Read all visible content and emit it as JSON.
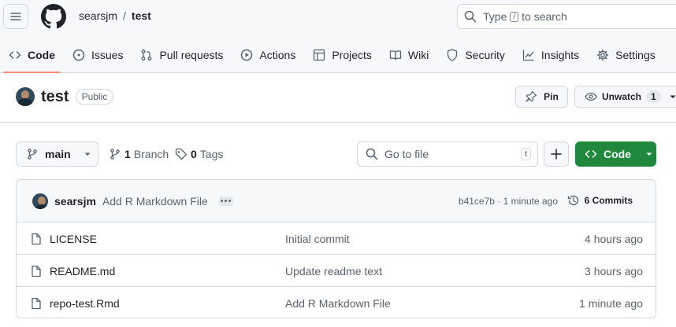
{
  "header": {
    "owner": "searsjm",
    "separator": "/",
    "repo": "test",
    "search_prefix": "Type",
    "search_key": "/",
    "search_suffix": "to search"
  },
  "tabs": [
    {
      "label": "Code",
      "icon": "code-icon",
      "active": true
    },
    {
      "label": "Issues",
      "icon": "issue-icon"
    },
    {
      "label": "Pull requests",
      "icon": "pull-request-icon"
    },
    {
      "label": "Actions",
      "icon": "play-icon"
    },
    {
      "label": "Projects",
      "icon": "table-icon"
    },
    {
      "label": "Wiki",
      "icon": "book-icon"
    },
    {
      "label": "Security",
      "icon": "shield-icon"
    },
    {
      "label": "Insights",
      "icon": "graph-icon"
    },
    {
      "label": "Settings",
      "icon": "gear-icon"
    }
  ],
  "repo_header": {
    "name": "test",
    "visibility": "Public",
    "pin_label": "Pin",
    "watch_label": "Unwatch",
    "watch_count": "1"
  },
  "toolbar": {
    "branch": "main",
    "branch_count": "1",
    "branch_label": "Branch",
    "tag_count": "0",
    "tag_label": "Tags",
    "goto_placeholder": "Go to file",
    "goto_key": "t",
    "code_label": "Code"
  },
  "latest_commit": {
    "author": "searsjm",
    "message": "Add R Markdown File",
    "hash_time": "b41ce7b · 1 minute ago",
    "commit_count": "6 Commits"
  },
  "files": [
    {
      "name": "LICENSE",
      "message": "Initial commit",
      "age": "4 hours ago"
    },
    {
      "name": "README.md",
      "message": "Update readme text",
      "age": "3 hours ago"
    },
    {
      "name": "repo-test.Rmd",
      "message": "Add R Markdown File",
      "age": "1 minute ago"
    }
  ],
  "colors": {
    "accent_green": "#1f883d",
    "tab_underline": "#fd8c73",
    "muted_text": "#59636e",
    "border": "#d1d9e0"
  }
}
